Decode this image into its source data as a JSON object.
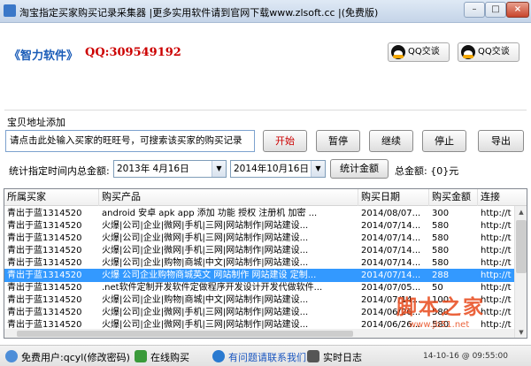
{
  "window": {
    "title": "淘宝指定买家购买记录采集器 |更多实用软件请到官网下载www.zlsoft.cc |(免费版)",
    "min": "–",
    "max": "□",
    "close": "×"
  },
  "header": {
    "brand": "《智力软件》",
    "qq_label": "QQ:309549192",
    "qq_btn1": "QQ交谈",
    "qq_btn2": "QQ交谈"
  },
  "controls": {
    "section_label": "宝贝地址添加",
    "url_input": "请点击此处输入买家的旺旺号，可搜索该买家的购买记录",
    "start": "开始",
    "pause": "暂停",
    "continue": "继续",
    "stop": "停止",
    "export": "导出",
    "range_label": "统计指定时间内总金额:",
    "date_from": "2013年 4月16日",
    "to_label": "到",
    "date_to": "2014年10月16日",
    "stat_btn": "统计金额",
    "total_label": "总金额: {0}元"
  },
  "table": {
    "columns": [
      "所属买家",
      "购买产品",
      "购买日期",
      "购买金额",
      "连接"
    ],
    "rows": [
      [
        "青出于蓝1314520",
        "android 安卓 apk app 添加 功能 授权 注册机 加密 ...",
        "2014/08/07...",
        "300",
        "http://t"
      ],
      [
        "青出于蓝1314520",
        "火爆|公司|企业|微网|手机|三网|网站制作|网站建设...",
        "2014/07/14...",
        "580",
        "http://t"
      ],
      [
        "青出于蓝1314520",
        "火爆|公司|企业|微网|手机|三网|网站制作|网站建设...",
        "2014/07/14...",
        "580",
        "http://t"
      ],
      [
        "青出于蓝1314520",
        "火爆|公司|企业|微网|手机|三网|网站制作|网站建设...",
        "2014/07/14...",
        "580",
        "http://t"
      ],
      [
        "青出于蓝1314520",
        "火爆|公司|企业|购物|商城|中文|网站制作|网站建设...",
        "2014/07/14...",
        "580",
        "http://t"
      ],
      [
        "青出于蓝1314520",
        "火爆 公司企业购物商城英文 网站制作 网站建设 定制...",
        "2014/07/14...",
        "288",
        "http://t"
      ],
      [
        "青出于蓝1314520",
        ".net软件定制开发软件定做程序开发设计开发代做软件...",
        "2014/07/05...",
        "50",
        "http://t"
      ],
      [
        "青出于蓝1314520",
        "火爆|公司|企业|购物|商城|中文|网站制作|网站建设...",
        "2014/07/14...",
        "100",
        "http://t"
      ],
      [
        "青出于蓝1314520",
        "火爆|公司|企业|微网|手机|三网|网站制作|网站建设...",
        "2014/06/26...",
        "580",
        "http://t"
      ],
      [
        "青出于蓝1314520",
        "火爆|公司|企业|微网|手机|三网|网站制作|网站建设...",
        "2014/06/26...",
        "580",
        "http://t"
      ],
      [
        "青出于蓝1314520",
        "火爆|公司|企业|微网|手机|三网|网站制作|网站建设...",
        "2014/06/26...",
        "580",
        "http://t"
      ]
    ],
    "selected_index": 5
  },
  "status": {
    "user": "免费用户:qcyl(修改密码)",
    "buy": "在线购买",
    "help": "有问题请联系我们",
    "log": "实时日志",
    "time": "14-10-16 @ 09:55:00"
  },
  "watermark": {
    "main": "脚本之家",
    "url": "www.jb51.net"
  }
}
